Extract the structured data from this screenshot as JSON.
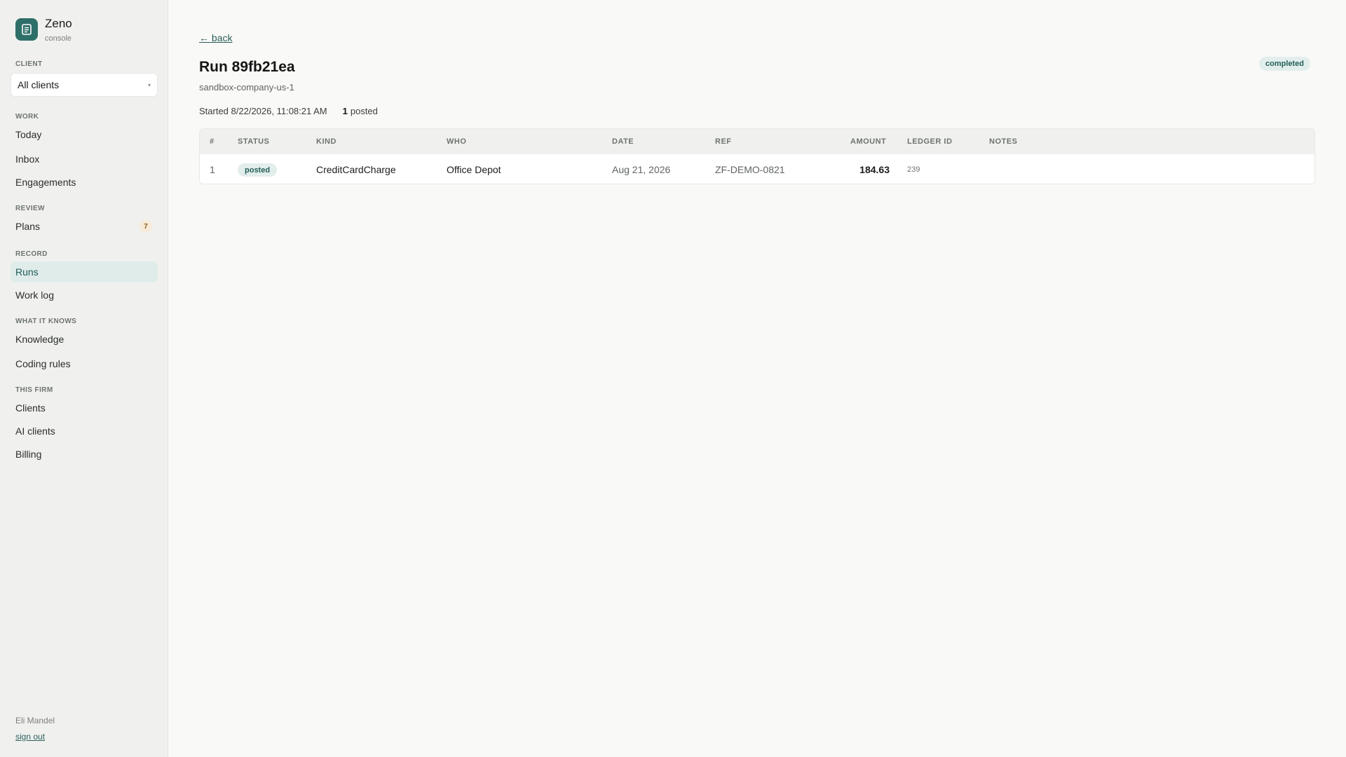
{
  "app": {
    "name": "Zeno",
    "subtitle": "console"
  },
  "sidebar": {
    "client_label": "CLIENT",
    "client_select_value": "All clients",
    "sections": [
      {
        "label": "WORK",
        "items": [
          {
            "label": "Today"
          },
          {
            "label": "Inbox"
          },
          {
            "label": "Engagements"
          }
        ]
      },
      {
        "label": "REVIEW",
        "items": [
          {
            "label": "Plans",
            "badge": "7"
          }
        ]
      },
      {
        "label": "RECORD",
        "items": [
          {
            "label": "Runs",
            "active": true
          },
          {
            "label": "Work log"
          }
        ]
      },
      {
        "label": "WHAT IT KNOWS",
        "items": [
          {
            "label": "Knowledge"
          },
          {
            "label": "Coding rules"
          }
        ]
      },
      {
        "label": "THIS FIRM",
        "items": [
          {
            "label": "Clients"
          },
          {
            "label": "AI clients"
          },
          {
            "label": "Billing"
          }
        ]
      }
    ],
    "user_name": "Eli Mandel",
    "sign_out": "sign out"
  },
  "main": {
    "back": "← back",
    "title": "Run 89fb21ea",
    "company": "sandbox-company-us-1",
    "status": "completed",
    "started": "Started 8/22/2026, 11:08:21 AM",
    "posted_count": "1",
    "posted_label": "posted",
    "table": {
      "headers": [
        "#",
        "STATUS",
        "KIND",
        "WHO",
        "DATE",
        "REF",
        "AMOUNT",
        "LEDGER ID",
        "NOTES"
      ],
      "rows": [
        {
          "num": "1",
          "status": "posted",
          "kind": "CreditCardCharge",
          "who": "Office Depot",
          "date": "Aug 21, 2026",
          "ref": "ZF-DEMO-0821",
          "amount": "184.63",
          "ledger_id": "239",
          "notes": ""
        }
      ]
    }
  },
  "colors": {
    "accent": "#2f6f69",
    "pill_bg": "#e2eeec",
    "pill_text": "#245e57",
    "active_nav_bg": "#e0ecea"
  },
  "icons": {
    "logo": "document-icon",
    "select_caret": "caret-down-icon"
  }
}
